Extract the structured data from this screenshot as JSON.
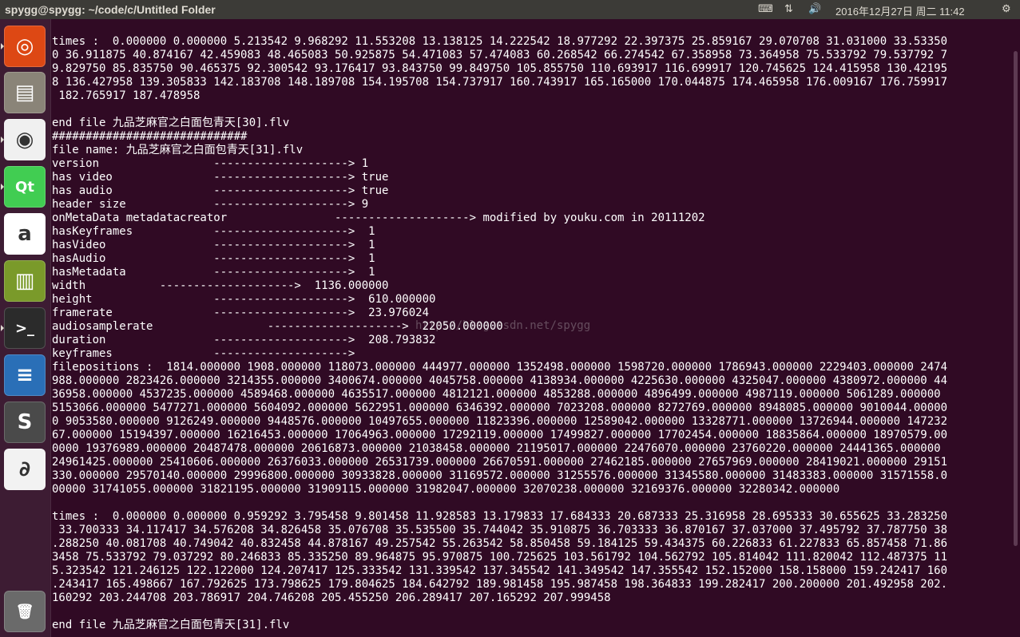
{
  "window": {
    "title": "spygg@spygg: ~/code/c/Untitled Folder"
  },
  "panel": {
    "datetime": "2016年12月27日 周二 11:42"
  },
  "launcher": {
    "items": [
      {
        "name": "ubuntu-dash",
        "color": "#dd4814",
        "glyph": "◎"
      },
      {
        "name": "files",
        "color": "#8a8478",
        "glyph": "▤"
      },
      {
        "name": "chrome",
        "color": "#f0f0f0",
        "glyph": "◉"
      },
      {
        "name": "qt-creator",
        "color": "#41cd52",
        "glyph": "Qt"
      },
      {
        "name": "a-app",
        "color": "#ffffff",
        "glyph": "a"
      },
      {
        "name": "book-reader",
        "color": "#7a9a2a",
        "glyph": "▥"
      },
      {
        "name": "terminal",
        "color": "#2b2b2b",
        "glyph": ">_"
      },
      {
        "name": "libreoffice-writer",
        "color": "#2a6fb7",
        "glyph": "≡"
      },
      {
        "name": "sublime-text",
        "color": "#4a4a4a",
        "glyph": "S"
      },
      {
        "name": "pdf-reader",
        "color": "#f2f2f2",
        "glyph": "∂"
      },
      {
        "name": "trash",
        "color": "#6a6a6a",
        "glyph": "🗑"
      }
    ]
  },
  "watermark": "http://blog.csdn.net/spygg",
  "terminal": {
    "lines": [
      "times :  0.000000 0.000000 5.213542 9.968292 11.553208 13.138125 14.222542 18.977292 22.397375 25.859167 29.070708 31.031000 33.53350",
      "0 36.911875 40.874167 42.459083 48.465083 50.925875 54.471083 57.474083 60.268542 66.274542 67.358958 73.364958 75.533792 79.537792 7",
      "9.829750 85.835750 90.465375 92.300542 93.176417 93.843750 99.849750 105.855750 110.693917 116.699917 120.745625 124.415958 130.42195",
      "8 136.427958 139.305833 142.183708 148.189708 154.195708 154.737917 160.743917 165.165000 170.044875 174.465958 176.009167 176.759917",
      " 182.765917 187.478958",
      "",
      "end file 九品芝麻官之白面包青天[30].flv",
      "#############################",
      "file name: 九品芝麻官之白面包青天[31].flv",
      "version                 --------------------> 1",
      "has video               --------------------> true",
      "has audio               --------------------> true",
      "header size             --------------------> 9",
      "onMetaData metadatacreator                --------------------> modified by youku.com in 20111202",
      "hasKeyframes            -------------------->  1",
      "hasVideo                -------------------->  1",
      "hasAudio                -------------------->  1",
      "hasMetadata             -------------------->  1",
      "width           -------------------->  1136.000000",
      "height                  -------------------->  610.000000",
      "framerate               -------------------->  23.976024",
      "audiosamplerate                 -------------------->  22050.000000",
      "duration                -------------------->  208.793832",
      "keyframes               -------------------->",
      "filepositions :  1814.000000 1908.000000 118073.000000 444977.000000 1352498.000000 1598720.000000 1786943.000000 2229403.000000 2474",
      "988.000000 2823426.000000 3214355.000000 3400674.000000 4045758.000000 4138934.000000 4225630.000000 4325047.000000 4380972.000000 44",
      "36958.000000 4537235.000000 4589468.000000 4635517.000000 4812121.000000 4853288.000000 4896499.000000 4987119.000000 5061289.000000",
      "5153066.000000 5477271.000000 5604092.000000 5622951.000000 6346392.000000 7023208.000000 8272769.000000 8948085.000000 9010044.00000",
      "0 9053580.000000 9126249.000000 9448576.000000 10497655.000000 11823396.000000 12589042.000000 13328771.000000 13726944.000000 147232",
      "67.000000 15194397.000000 16216453.000000 17064963.000000 17292119.000000 17499827.000000 17702454.000000 18835864.000000 18970579.00",
      "0000 19376989.000000 20487478.000000 20616873.000000 21038458.000000 21195017.000000 22476070.000000 23760220.000000 24441365.000000",
      "24961425.000000 25410606.000000 26376033.000000 26531739.000000 26670591.000000 27462185.000000 27657969.000000 28419021.000000 29151",
      "330.000000 29570140.000000 29996800.000000 30933828.000000 31169572.000000 31255576.000000 31345580.000000 31483383.000000 31571558.0",
      "00000 31741055.000000 31821195.000000 31909115.000000 31982047.000000 32070238.000000 32169376.000000 32280342.000000",
      "",
      "times :  0.000000 0.000000 0.959292 3.795458 9.801458 11.928583 13.179833 17.684333 20.687333 25.316958 28.695333 30.655625 33.283250",
      " 33.700333 34.117417 34.576208 34.826458 35.076708 35.535500 35.744042 35.910875 36.703333 36.870167 37.037000 37.495792 37.787750 38",
      ".288250 40.081708 40.749042 40.832458 44.878167 49.257542 55.263542 58.850458 59.184125 59.434375 60.226833 61.227833 65.857458 71.86",
      "3458 75.533792 79.037292 80.246833 85.335250 89.964875 95.970875 100.725625 103.561792 104.562792 105.814042 111.820042 112.487375 11",
      "5.323542 121.246125 122.122000 124.207417 125.333542 131.339542 137.345542 141.349542 147.355542 152.152000 158.158000 159.242417 160",
      ".243417 165.498667 167.792625 173.798625 179.804625 184.642792 189.981458 195.987458 198.364833 199.282417 200.200000 201.492958 202.",
      "160292 203.244708 203.786917 204.746208 205.455250 206.289417 207.165292 207.999458",
      "",
      "end file 九品芝麻官之白面包青天[31].flv"
    ]
  }
}
